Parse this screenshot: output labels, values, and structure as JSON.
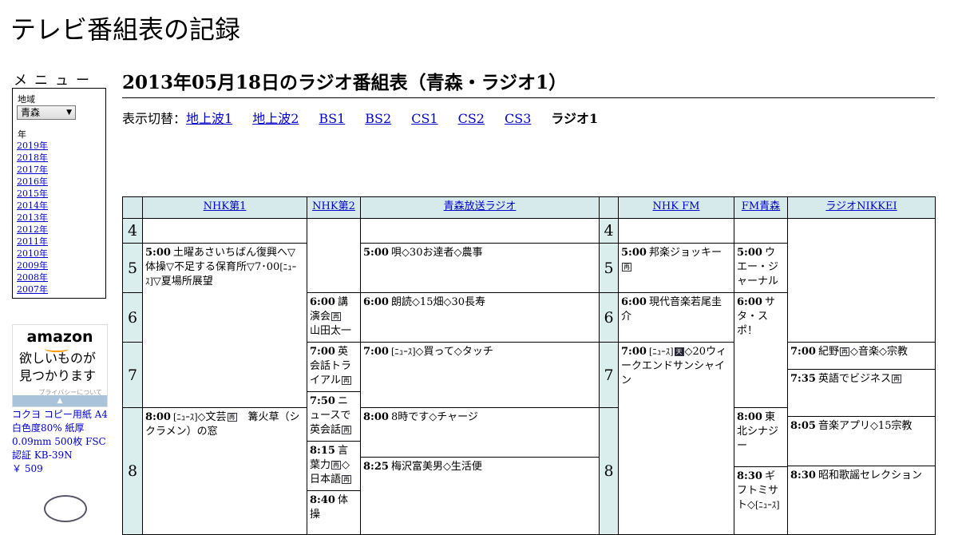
{
  "site_title": "テレビ番組表の記録",
  "menu": {
    "title": "メニュー",
    "region_label": "地域",
    "region_value": "青森",
    "year_label": "年",
    "years": [
      "2019年",
      "2018年",
      "2017年",
      "2016年",
      "2015年",
      "2014年",
      "2013年",
      "2012年",
      "2011年",
      "2010年",
      "2009年",
      "2008年",
      "2007年"
    ]
  },
  "ad": {
    "logo": "amazon",
    "line1": "欲しいものが",
    "line2": "見つかります",
    "privacy": "プライバシーについて",
    "bar": "▲"
  },
  "product": {
    "name": "コクヨ コピー用紙 A4 白色度80% 紙厚 0.09mm 500枚 FSC認証 KB-39N",
    "price": "￥ 509"
  },
  "page_title": "2013年05月18日のラジオ番組表（青森・ラジオ1）",
  "switcher": {
    "label": "表示切替：",
    "links": [
      "地上波1",
      "地上波2",
      "BS1",
      "BS2",
      "CS1",
      "CS2",
      "CS3"
    ],
    "current": "ラジオ1"
  },
  "schedule": {
    "hours": [
      "4",
      "5",
      "6",
      "7",
      "8"
    ],
    "channels": [
      "NHK第1",
      "NHK第2",
      "青森放送ラジオ",
      "NHK FM",
      "FM青森",
      "ラジオNIKKEI"
    ],
    "programs": {
      "nhk1_a": {
        "time": "5:00",
        "title": "土曜あさいちばん復興へ▽体操▽不足する保育所▽7･00",
        "news": "[ﾆｭｰｽ]",
        "title2": "▽夏場所展望"
      },
      "nhk1_b": {
        "time": "8:00",
        "news": "[ﾆｭｰｽ]",
        "title": "◇文芸",
        "icon": "再",
        "title2": "篝火草（シクラメン）の窓"
      },
      "nhk2_a": {
        "time": "6:00",
        "title": "講演会",
        "icon": "再",
        "title2": "山田太一"
      },
      "nhk2_b": {
        "time": "7:00",
        "title": "英会話トライアル",
        "icon": "再"
      },
      "nhk2_c": {
        "time": "7:50",
        "title": "ニュースで英会話",
        "icon": "再"
      },
      "nhk2_d": {
        "time": "8:15",
        "title": "言葉力",
        "icon": "再",
        "title2": "◇日本語",
        "icon2": "再"
      },
      "nhk2_e": {
        "time": "8:40",
        "title": "体操"
      },
      "rab_a": {
        "time": "5:00",
        "title": "唄◇30お達者◇農事"
      },
      "rab_b": {
        "time": "6:00",
        "title": "朗読◇15畑◇30長寿"
      },
      "rab_c": {
        "time": "7:00",
        "news": "[ﾆｭｰｽ]",
        "title": "◇買って◇タッチ"
      },
      "rab_d": {
        "time": "8:00",
        "title": "8時です◇チャージ"
      },
      "rab_e": {
        "time": "8:25",
        "title": "梅沢富美男◇生活便"
      },
      "fm_a": {
        "time": "5:00",
        "title": "邦楽ジョッキー",
        "icon": "再"
      },
      "fm_b": {
        "time": "6:00",
        "title": "現代音楽若尾圭介"
      },
      "fm_c": {
        "time": "7:00",
        "news": "[ﾆｭｰｽ]",
        "icon": "天",
        "title": "◇20ウィークエンドサンシャイン"
      },
      "afm_a": {
        "time": "5:00",
        "title": "ウエー・ジャーナル"
      },
      "afm_b": {
        "time": "6:00",
        "title": "サタ・スポ！"
      },
      "afm_c": {
        "time": "8:00",
        "title": "東北シナジー"
      },
      "afm_d": {
        "time": "8:30",
        "title": "ギフトミサト◇",
        "news": "[ﾆｭｰｽ]"
      },
      "nk_a": {
        "time": "7:00",
        "title": "紀野",
        "icon": "再",
        "title2": "◇音楽◇宗教"
      },
      "nk_b": {
        "time": "7:35",
        "title": "英語でビジネス",
        "icon": "再"
      },
      "nk_c": {
        "time": "8:05",
        "title": "音楽アプリ◇15宗教"
      },
      "nk_d": {
        "time": "8:30",
        "title": "昭和歌謡セレクション"
      }
    }
  }
}
